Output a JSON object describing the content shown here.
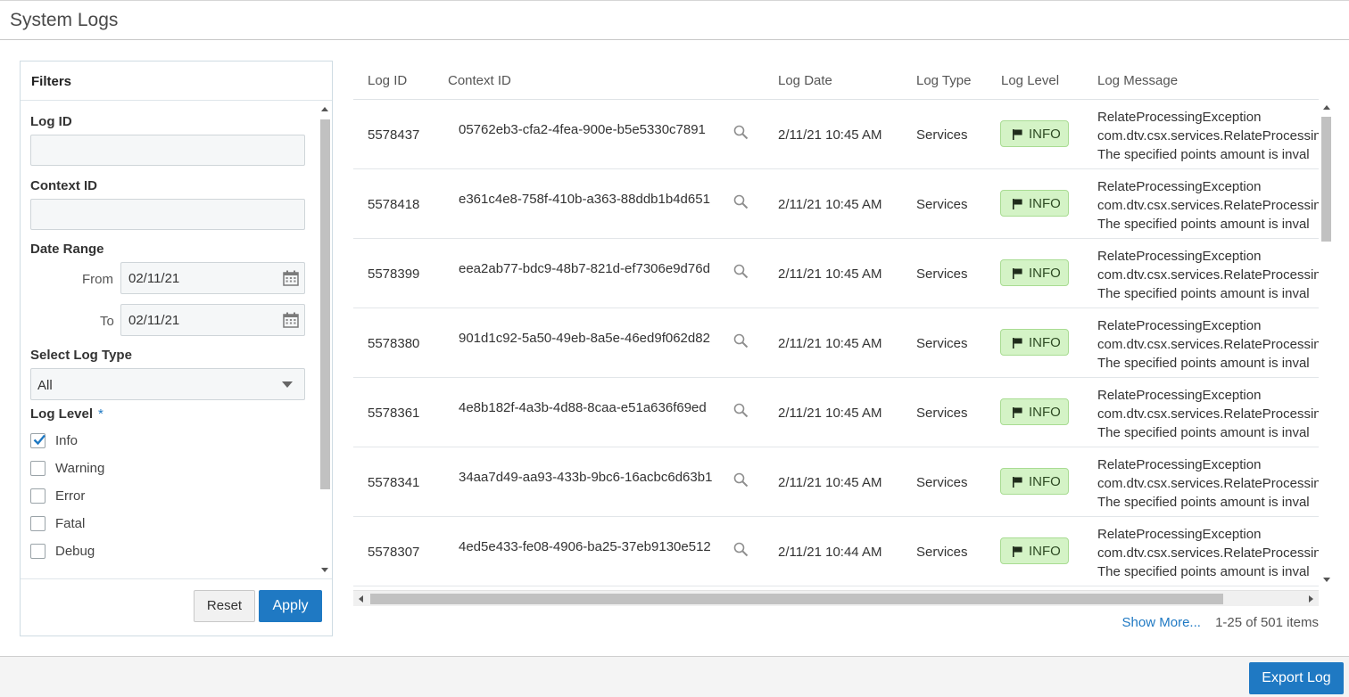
{
  "page": {
    "title": "System Logs"
  },
  "filters": {
    "heading": "Filters",
    "log_id": {
      "label": "Log ID",
      "value": ""
    },
    "context_id": {
      "label": "Context ID",
      "value": ""
    },
    "date_range": {
      "label": "Date Range",
      "from_label": "From",
      "from_value": "02/11/21",
      "to_label": "To",
      "to_value": "02/11/21"
    },
    "log_type": {
      "label": "Select Log Type",
      "selected": "All"
    },
    "log_level": {
      "label": "Log Level",
      "required_mark": "*",
      "options": [
        {
          "label": "Info",
          "checked": true
        },
        {
          "label": "Warning",
          "checked": false
        },
        {
          "label": "Error",
          "checked": false
        },
        {
          "label": "Fatal",
          "checked": false
        },
        {
          "label": "Debug",
          "checked": false
        }
      ]
    },
    "reset_label": "Reset",
    "apply_label": "Apply"
  },
  "table": {
    "columns": [
      "Log ID",
      "Context ID",
      "Log Date",
      "Log Type",
      "Log Level",
      "Log Message"
    ],
    "rows": [
      {
        "log_id": "5578437",
        "context_id": "05762eb3-cfa2-4fea-900e-b5e5330c7891",
        "date": "2/11/21 10:45 AM",
        "type": "Services",
        "level": "INFO",
        "msg1": "RelateProcessingException",
        "msg2": "com.dtv.csx.services.RelateProcessin",
        "msg3": "The specified points amount is inval"
      },
      {
        "log_id": "5578418",
        "context_id": "e361c4e8-758f-410b-a363-88ddb1b4d651",
        "date": "2/11/21 10:45 AM",
        "type": "Services",
        "level": "INFO",
        "msg1": "RelateProcessingException",
        "msg2": "com.dtv.csx.services.RelateProcessin",
        "msg3": "The specified points amount is inval"
      },
      {
        "log_id": "5578399",
        "context_id": "eea2ab77-bdc9-48b7-821d-ef7306e9d76d",
        "date": "2/11/21 10:45 AM",
        "type": "Services",
        "level": "INFO",
        "msg1": "RelateProcessingException",
        "msg2": "com.dtv.csx.services.RelateProcessin",
        "msg3": "The specified points amount is inval"
      },
      {
        "log_id": "5578380",
        "context_id": "901d1c92-5a50-49eb-8a5e-46ed9f062d82",
        "date": "2/11/21 10:45 AM",
        "type": "Services",
        "level": "INFO",
        "msg1": "RelateProcessingException",
        "msg2": "com.dtv.csx.services.RelateProcessin",
        "msg3": "The specified points amount is inval"
      },
      {
        "log_id": "5578361",
        "context_id": "4e8b182f-4a3b-4d88-8caa-e51a636f69ed",
        "date": "2/11/21 10:45 AM",
        "type": "Services",
        "level": "INFO",
        "msg1": "RelateProcessingException",
        "msg2": "com.dtv.csx.services.RelateProcessin",
        "msg3": "The specified points amount is inval"
      },
      {
        "log_id": "5578341",
        "context_id": "34aa7d49-aa93-433b-9bc6-16acbc6d63b1",
        "date": "2/11/21 10:45 AM",
        "type": "Services",
        "level": "INFO",
        "msg1": "RelateProcessingException",
        "msg2": "com.dtv.csx.services.RelateProcessin",
        "msg3": "The specified points amount is inval"
      },
      {
        "log_id": "5578307",
        "context_id": "4ed5e433-fe08-4906-ba25-37eb9130e512",
        "date": "2/11/21 10:44 AM",
        "type": "Services",
        "level": "INFO",
        "msg1": "RelateProcessingException",
        "msg2": "com.dtv.csx.services.RelateProcessin",
        "msg3": "The specified points amount is inval"
      }
    ]
  },
  "pager": {
    "show_more": "Show More...",
    "count": "1-25 of 501 items"
  },
  "footer": {
    "export_label": "Export Log"
  },
  "colors": {
    "accent": "#1f79c3",
    "badge_bg": "#d4f3c6",
    "badge_border": "#a9dc93"
  },
  "icons": {
    "date_picker": "calendar-icon",
    "context_lookup": "magnifier-icon",
    "level_flag": "flag-icon",
    "checked": "checkmark-icon"
  }
}
